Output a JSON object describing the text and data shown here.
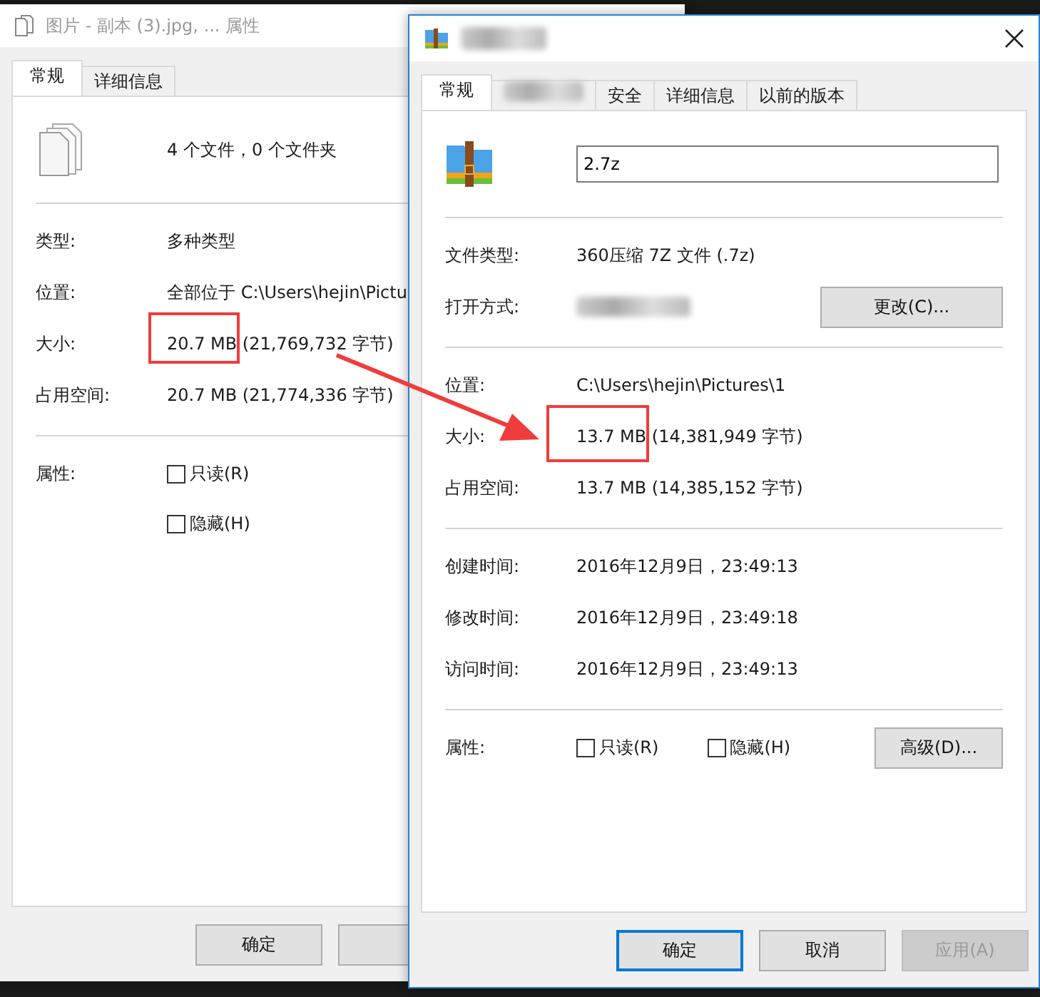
{
  "windows": [
    {
      "title": {
        "kind": "text",
        "text": "图片 - 副本 (3).jpg, ... 属性"
      },
      "kind": "multi-file",
      "close": false,
      "tabs": [
        {
          "kind": "text",
          "label": "常规",
          "selected": true
        },
        {
          "kind": "text",
          "label": "详细信息",
          "selected": false
        }
      ],
      "header": {
        "kind": "text",
        "text": "4 个文件，0 个文件夹"
      },
      "sections": [
        [
          {
            "kind": "text",
            "label": "类型:",
            "value": "多种类型"
          },
          {
            "kind": "text",
            "label": "位置:",
            "value": "全部位于 C:\\Users\\hejin\\Pictu"
          },
          {
            "kind": "text",
            "label": "大小:",
            "value": "20.7 MB (21,769,732 字节)"
          },
          {
            "kind": "text",
            "label": "占用空间:",
            "value": "20.7 MB (21,774,336 字节)"
          }
        ],
        [
          {
            "kind": "checkbox-stack",
            "label": "属性:",
            "checkboxes": [
              {
                "label": "只读(R)",
                "checked": false
              },
              {
                "label": "隐藏(H)",
                "checked": false
              }
            ]
          }
        ]
      ],
      "buttons": [
        {
          "kind": "text",
          "label": "确定",
          "default": false,
          "disabled": false
        },
        {
          "kind": "covered"
        }
      ]
    },
    {
      "title": {
        "kind": "redacted"
      },
      "kind": "archive",
      "close": true,
      "tabs": [
        {
          "kind": "text",
          "label": "常规",
          "selected": true
        },
        {
          "kind": "redacted",
          "selected": false
        },
        {
          "kind": "text",
          "label": "安全",
          "selected": false
        },
        {
          "kind": "text",
          "label": "详细信息",
          "selected": false
        },
        {
          "kind": "text",
          "label": "以前的版本",
          "selected": false
        }
      ],
      "header": {
        "kind": "field",
        "value": "2.7z"
      },
      "sections": [
        [
          {
            "kind": "text",
            "label": "文件类型:",
            "value": "360压缩 7Z 文件 (.7z)"
          },
          {
            "kind": "redacted",
            "label": "打开方式:",
            "button": "更改(C)..."
          }
        ],
        [
          {
            "kind": "text",
            "label": "位置:",
            "value": "C:\\Users\\hejin\\Pictures\\1"
          },
          {
            "kind": "text",
            "label": "大小:",
            "value": "13.7 MB (14,381,949 字节)"
          },
          {
            "kind": "text",
            "label": "占用空间:",
            "value": "13.7 MB (14,385,152 字节)"
          }
        ],
        [
          {
            "kind": "text",
            "label": "创建时间:",
            "value": "2016年12月9日，23:49:13"
          },
          {
            "kind": "text",
            "label": "修改时间:",
            "value": "2016年12月9日，23:49:18"
          },
          {
            "kind": "text",
            "label": "访问时间:",
            "value": "2016年12月9日，23:49:13"
          }
        ],
        [
          {
            "kind": "checkbox-row",
            "label": "属性:",
            "checkboxes": [
              {
                "label": "只读(R)",
                "checked": false
              },
              {
                "label": "隐藏(H)",
                "checked": false
              }
            ],
            "button": "高级(D)..."
          }
        ]
      ],
      "buttons": [
        {
          "kind": "text",
          "label": "确定",
          "default": true,
          "disabled": false
        },
        {
          "kind": "text",
          "label": "取消",
          "default": false,
          "disabled": false
        },
        {
          "kind": "text",
          "label": "应用(A)",
          "default": false,
          "disabled": true
        }
      ]
    }
  ],
  "annotations": [
    {
      "kind": "box"
    },
    {
      "kind": "box"
    },
    {
      "kind": "arrow"
    }
  ]
}
